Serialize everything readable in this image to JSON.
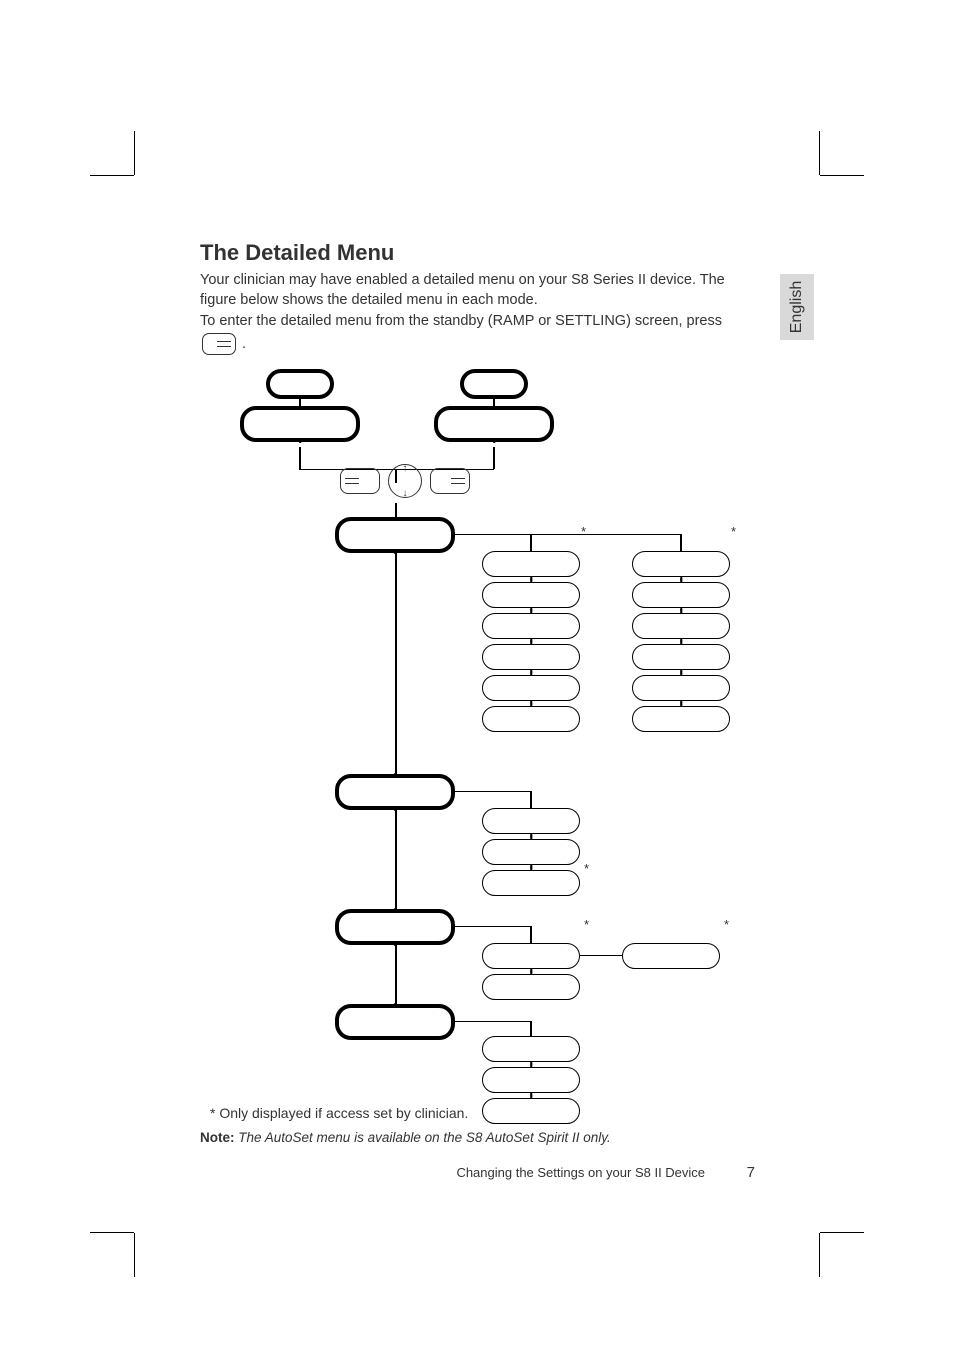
{
  "language_tab": "English",
  "heading": "The Detailed Menu",
  "paragraph": "Your clinician may have enabled a detailed menu on your S8 Series II device. The figure below shows the detailed menu in each mode.",
  "instruction_prefix": "To enter the detailed menu from the standby (RAMP or SETTLING) screen, press",
  "instruction_suffix": ".",
  "asterisks": [
    "*",
    "*",
    "*",
    "*",
    "*"
  ],
  "figure_caption": "* Only displayed if access set by clinician.",
  "note_label": "Note:",
  "note_text": " The AutoSet menu is available on the S8 AutoSet Spirit II only.",
  "footer_title": "Changing the Settings on your S8 II Device",
  "page_number": "7",
  "icons": {
    "right_button": "right-button-icon",
    "device_left": "device-left-button",
    "device_dial": "device-dial",
    "device_right": "device-right-button"
  }
}
